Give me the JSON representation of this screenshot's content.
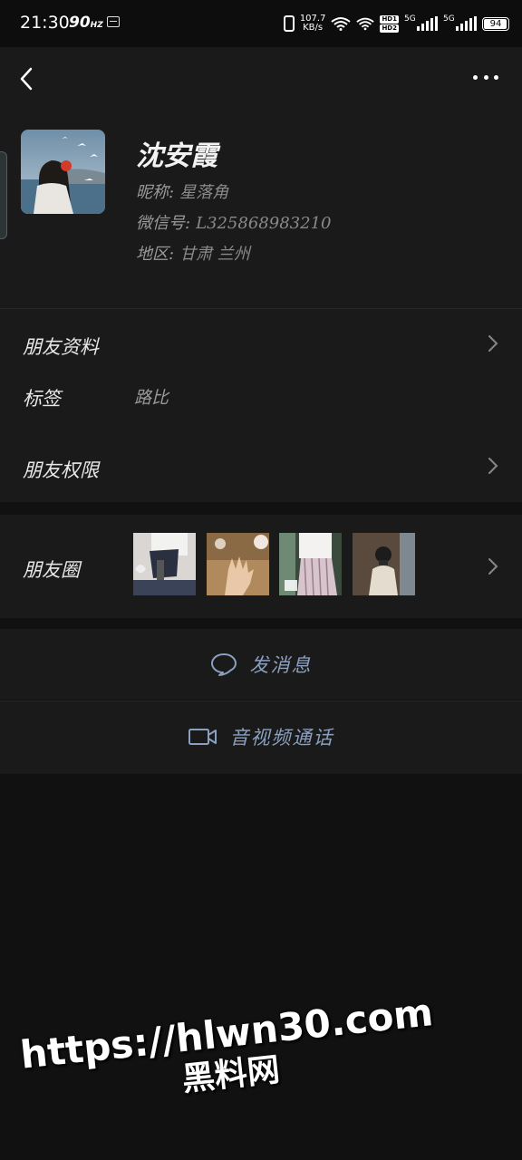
{
  "status_bar": {
    "time": "21:30",
    "refresh_rate": "90",
    "refresh_unit": "HZ",
    "net_speed_value": "107.7",
    "net_speed_unit": "KB/s",
    "hd1": "HD1",
    "hd2": "HD2",
    "sim1_type": "5G",
    "sim2_type": "5G",
    "battery": "94",
    "icons": [
      "notification-icon",
      "vibrate-icon",
      "wifi-icon",
      "signal-icon",
      "battery-icon"
    ]
  },
  "nav": {
    "back_icon": "back-arrow-icon",
    "more_icon": "more-dots-icon"
  },
  "profile": {
    "name": "沈安霞",
    "nickname_label": "昵称:",
    "nickname": "星落角",
    "wechat_id_label": "微信号:",
    "wechat_id": "L325868983210",
    "region_label": "地区:",
    "region": "甘肃  兰州"
  },
  "rows": {
    "friend_info": "朋友资料",
    "tags_label": "标签",
    "tags_value": "路比",
    "friend_permissions": "朋友权限",
    "moments": "朋友圈"
  },
  "actions": {
    "message": "发消息",
    "video_call": "音视频通话"
  },
  "watermark": {
    "url": "https://hlwn30.com",
    "brand": "黑料网"
  },
  "colors": {
    "background": "#111111",
    "card": "#1a1a1a",
    "action_text": "#8aa0c0"
  }
}
